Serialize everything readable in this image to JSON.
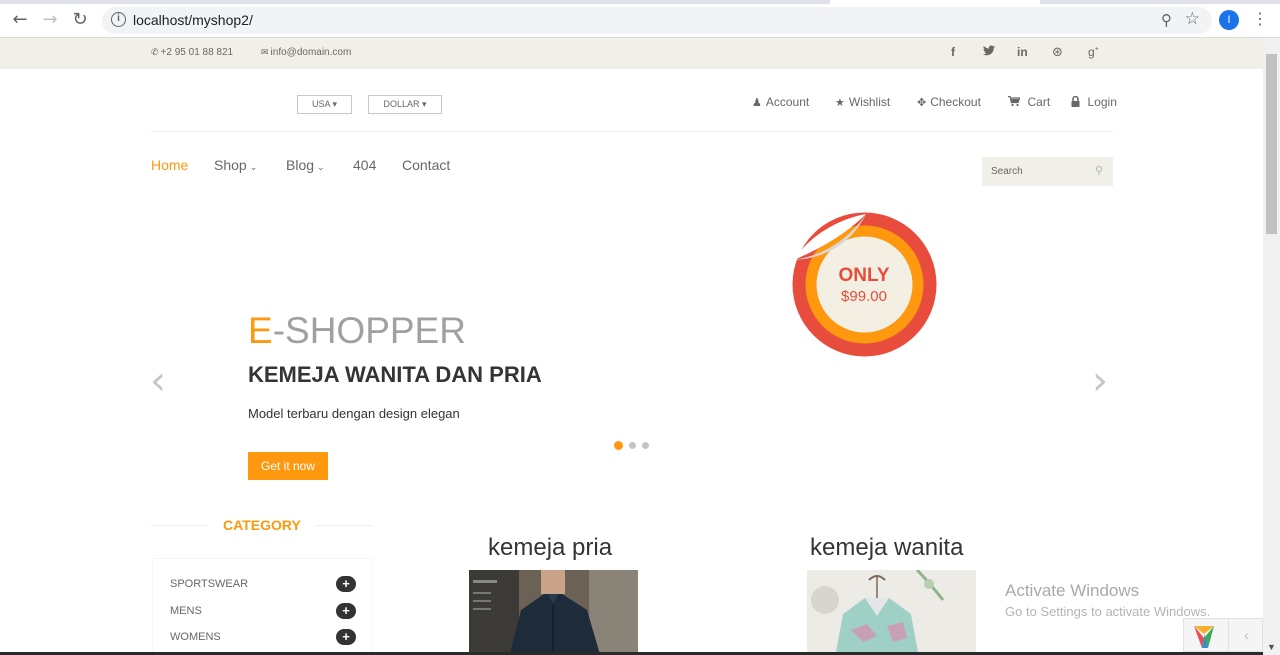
{
  "browser": {
    "url": "localhost/myshop2/",
    "profile_initial": "I",
    "back_icon": "arrow-left-icon",
    "forward_icon": "arrow-right-icon",
    "reload_icon": "reload-icon"
  },
  "topbar": {
    "phone": "+2 95 01 88 821",
    "email": "info@domain.com",
    "social": [
      "f",
      "t",
      "in",
      "dribbble",
      "g+"
    ]
  },
  "header": {
    "country": "USA",
    "currency": "DOLLAR",
    "menu": [
      {
        "label": "Account",
        "icon": "user-icon",
        "glyph": "👤"
      },
      {
        "label": "Wishlist",
        "icon": "star-icon",
        "glyph": "★"
      },
      {
        "label": "Checkout",
        "icon": "crosshairs-icon",
        "glyph": "⌖"
      },
      {
        "label": "Cart",
        "icon": "cart-icon",
        "glyph": "🛒"
      },
      {
        "label": "Login",
        "icon": "lock-icon",
        "glyph": "🔒"
      }
    ]
  },
  "nav": {
    "items": [
      "Home",
      "Shop",
      "Blog",
      "404",
      "Contact"
    ],
    "active": "Home",
    "search_placeholder": "Search"
  },
  "slider": {
    "brand_first": "E",
    "brand_rest": "-SHOPPER",
    "title": "KEMEJA WANITA DAN PRIA",
    "description": "Model terbaru dengan design elegan",
    "button": "Get it now",
    "badge_top": "ONLY",
    "badge_price": "$99.00",
    "slides": 3,
    "active_slide": 1
  },
  "category": {
    "title": "CATEGORY",
    "items": [
      "SPORTSWEAR",
      "MENS",
      "WOMENS"
    ]
  },
  "products": [
    {
      "title": "kemeja pria"
    },
    {
      "title": "kemeja wanita"
    }
  ],
  "watermark": {
    "line1": "Activate Windows",
    "line2": "Go to Settings to activate Windows."
  },
  "colors": {
    "accent": "#fe980f",
    "topbar_bg": "#f0f0e9",
    "text": "#696763"
  }
}
